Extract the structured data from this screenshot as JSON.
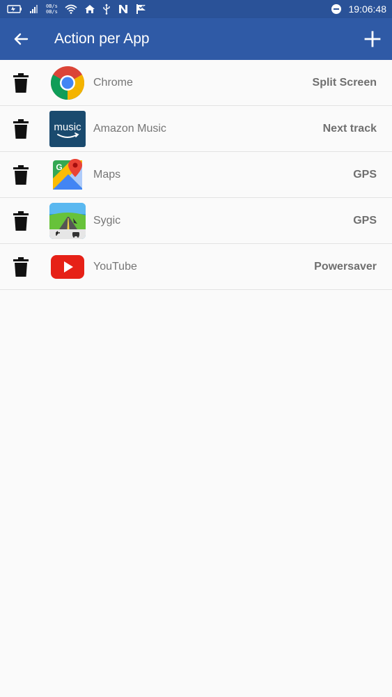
{
  "status_bar": {
    "net_speed_up": "0B/s",
    "net_speed_down": "0B/s",
    "time": "19:06:48"
  },
  "app_bar": {
    "title": "Action per App"
  },
  "apps": [
    {
      "name": "Chrome",
      "action": "Split Screen",
      "icon": "chrome-icon"
    },
    {
      "name": "Amazon Music",
      "action": "Next track",
      "icon": "amazon-music-icon",
      "icon_text": "music"
    },
    {
      "name": "Maps",
      "action": "GPS",
      "icon": "google-maps-icon",
      "icon_text": "G"
    },
    {
      "name": "Sygic",
      "action": "GPS",
      "icon": "sygic-icon"
    },
    {
      "name": "YouTube",
      "action": "Powersaver",
      "icon": "youtube-icon"
    }
  ],
  "colors": {
    "status_bar": "#2a5298",
    "app_bar": "#2f5aa6",
    "text_secondary": "#757575",
    "list_background": "#fafafa"
  }
}
